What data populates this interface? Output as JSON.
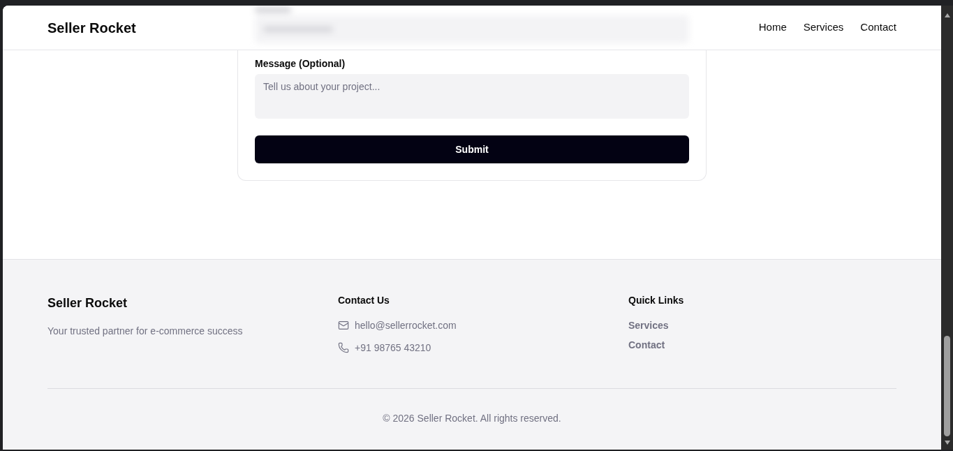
{
  "header": {
    "brand": "Seller Rocket",
    "nav": [
      "Home",
      "Services",
      "Contact"
    ]
  },
  "form": {
    "message": {
      "label": "Message (Optional)",
      "placeholder": "Tell us about your project..."
    },
    "submit": "Submit"
  },
  "footer": {
    "brand": "Seller Rocket",
    "tagline": "Your trusted partner for e-commerce success",
    "contact": {
      "title": "Contact Us",
      "items": [
        {
          "kind": "email",
          "text": "hello@sellerrocket.com"
        },
        {
          "kind": "phone",
          "text": "+91 98765 43210"
        }
      ]
    },
    "quick_links": {
      "title": "Quick Links",
      "links": [
        "Services",
        "Contact"
      ]
    },
    "copyright": "© 2026 Seller Rocket. All rights reserved."
  }
}
